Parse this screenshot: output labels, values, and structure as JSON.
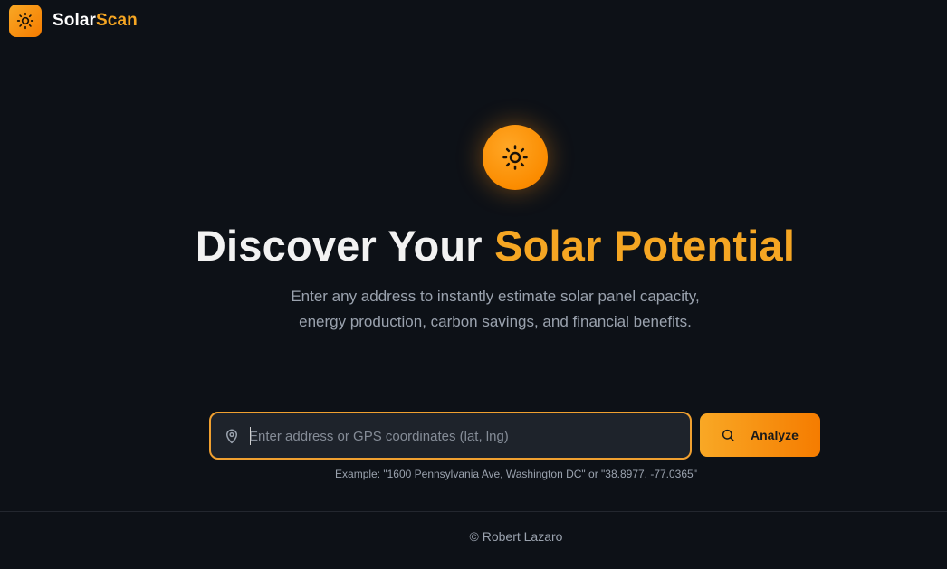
{
  "brand": {
    "name_part1": "Solar",
    "name_part2": "Scan",
    "icon": "sun-icon",
    "accent_color": "#f5a623"
  },
  "hero": {
    "icon": "sun-icon",
    "title_part1": "Discover Your ",
    "title_part2": "Solar Potential",
    "subtitle_line1": "Enter any address to instantly estimate solar panel capacity,",
    "subtitle_line2": "energy production, carbon savings, and financial benefits."
  },
  "search": {
    "icon": "map-pin-icon",
    "placeholder": "Enter address or GPS coordinates (lat, lng)",
    "value": "",
    "button_icon": "search-icon",
    "button_label": "Analyze",
    "example": "Example: \"1600 Pennsylvania Ave, Washington DC\" or \"38.8977, -77.0365\""
  },
  "footer": {
    "text": "© Robert Lazaro"
  }
}
